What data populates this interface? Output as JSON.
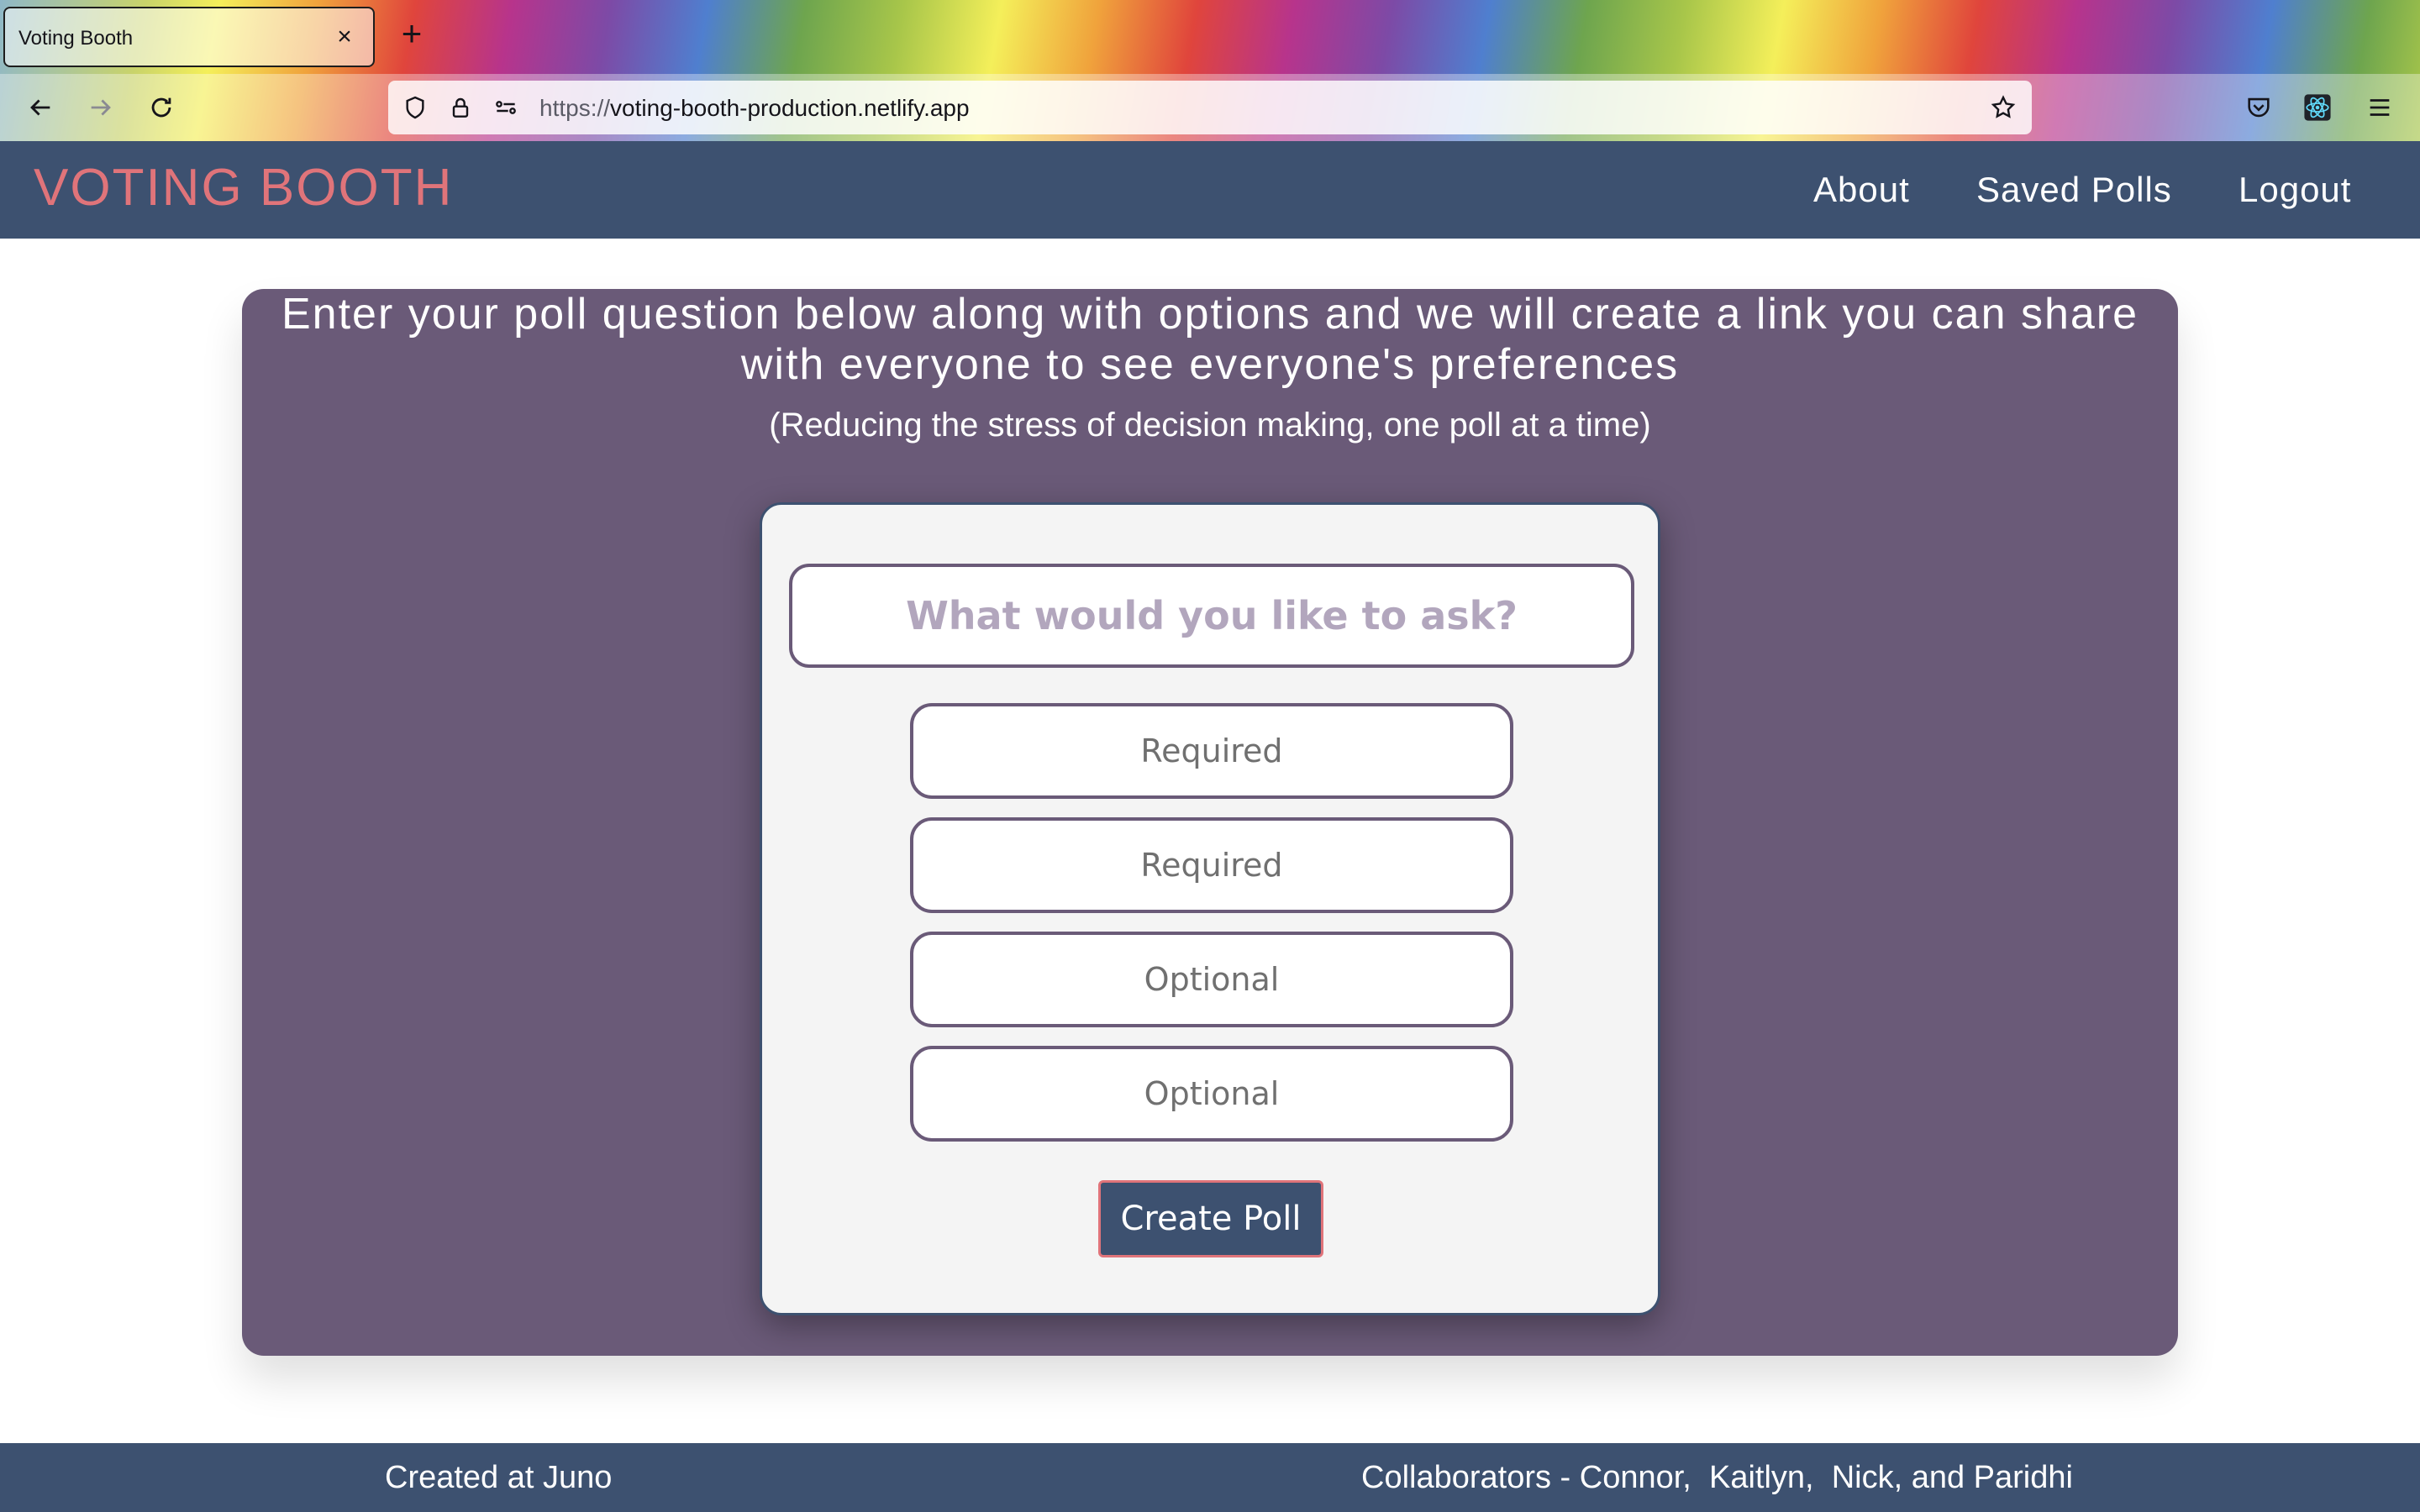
{
  "browser": {
    "tab_title": "Voting Booth",
    "tab_close": "×",
    "new_tab": "+",
    "url_scheme": "https://",
    "url_host": "voting-booth-production.netlify.app"
  },
  "header": {
    "logo": "VOTING BOOTH",
    "nav": [
      "About",
      "Saved Polls",
      "Logout"
    ]
  },
  "main": {
    "headline": "Enter your poll question below along with options and we will create a link you can share with everyone to see everyone's preferences",
    "tagline": "(Reducing the stress of decision making, one poll at a time)"
  },
  "form": {
    "question_placeholder": "What would you like to ask?",
    "option_placeholders": [
      "Required",
      "Required",
      "Optional",
      "Optional"
    ],
    "submit_label": "Create Poll"
  },
  "footer": {
    "created": "Created at Juno",
    "collaborators": "Collaborators - Connor,  Kaitlyn,  Nick, and Paridhi"
  },
  "colors": {
    "header_bg": "#3d5170",
    "logo": "#e0747a",
    "panel_bg": "#6a5a78",
    "card_bg": "#f4f4f4"
  }
}
